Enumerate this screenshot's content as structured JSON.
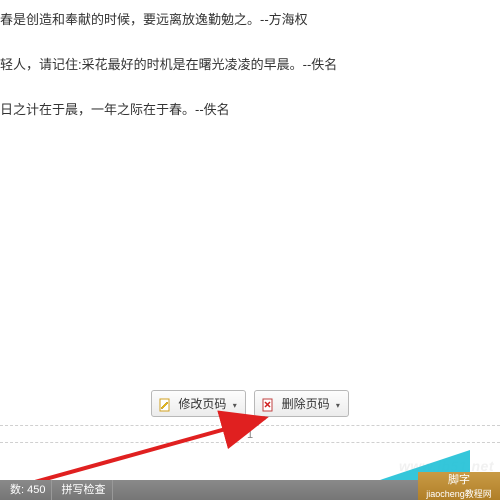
{
  "content": {
    "line1": "春是创造和奉献的时候，要远离放逸勤勉之。--方海权",
    "line2": "轻人，请记住:采花最好的时机是在曙光凌凌的早晨。--佚名",
    "line3": "日之计在于晨，一年之际在于春。--佚名"
  },
  "toolbar": {
    "modify_label": "修改页码",
    "delete_label": "删除页码"
  },
  "page_number": "1",
  "status": {
    "count_label": "数:",
    "count_value": "450",
    "spellcheck_label": "拼写检查"
  },
  "watermark": {
    "url": "www.jb51.net",
    "brand_line1": "脚字",
    "brand_line2": "jiaocheng教程网"
  }
}
